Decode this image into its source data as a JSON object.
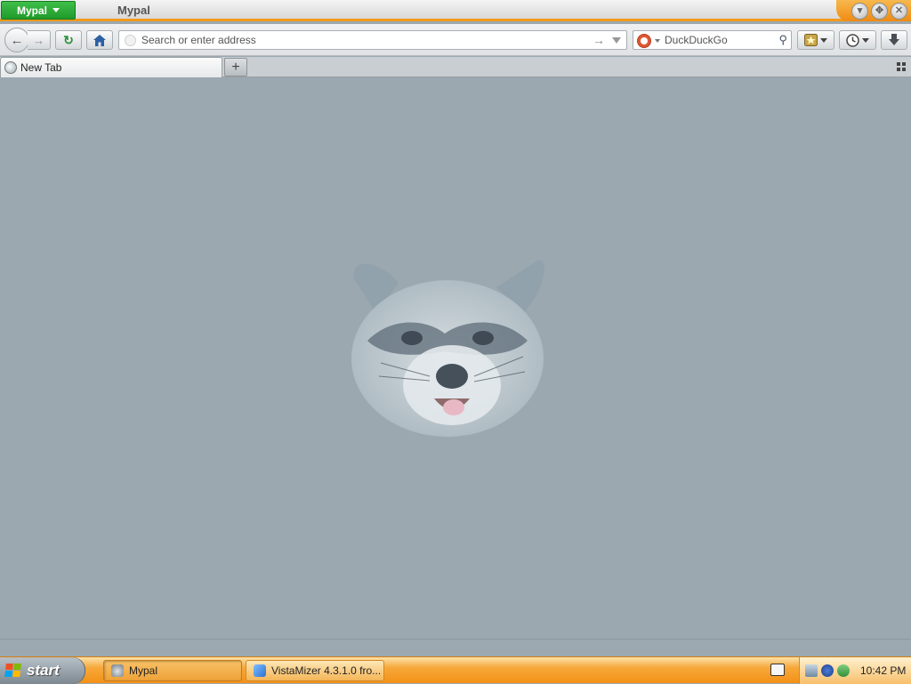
{
  "window": {
    "app_menu_label": "Mypal",
    "title": "Mypal"
  },
  "toolbar": {
    "url_placeholder": "Search or enter address",
    "search_placeholder": "DuckDuckGo"
  },
  "tabs": [
    {
      "label": "New Tab",
      "active": true
    }
  ],
  "taskbar": {
    "start_label": "start",
    "tasks": [
      {
        "label": "Mypal",
        "active": true
      },
      {
        "label": "VistaMizer 4.3.1.0 fro..."
      }
    ],
    "clock": "10:42 PM"
  },
  "icons": {
    "back": "arrow-left-icon",
    "forward": "arrow-right-icon",
    "reload": "reload-icon",
    "home": "home-icon",
    "search_engine": "duckduckgo-icon",
    "bookmarks": "bookmarks-icon",
    "history": "history-icon",
    "downloads": "download-icon",
    "new_tab": "plus-icon",
    "tab_list": "tab-list-icon",
    "mascot": "raccoon-logo"
  },
  "colors": {
    "title_accent": "#f39a1d",
    "app_menu": "#2aa836",
    "content_bg": "#9ba8b0",
    "taskbar": "#f39117"
  }
}
